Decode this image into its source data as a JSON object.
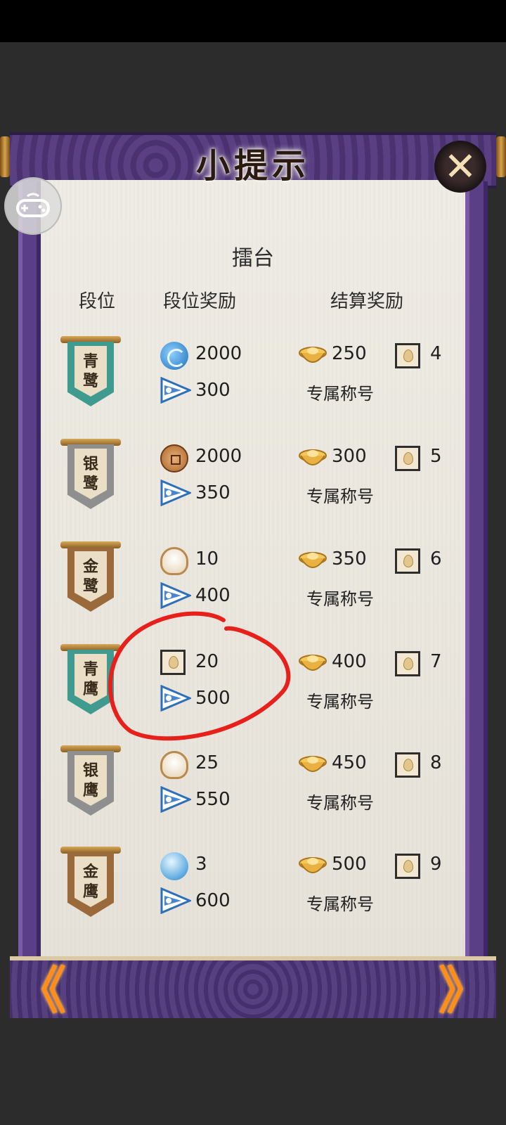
{
  "dialog": {
    "title": "小提示",
    "close_label": "✕",
    "prev_label": "《",
    "next_label": "》"
  },
  "section": {
    "title": "擂台"
  },
  "columns": {
    "rank": "段位",
    "rank_reward": "段位奖励",
    "settle_reward": "结算奖励"
  },
  "rows": [
    {
      "rank_name_top": "青",
      "rank_name_bottom": "鹭",
      "banner_color": "#3f9b8f",
      "reward1_icon": "swirl-icon",
      "reward1": "2000",
      "reward2_icon": "flag-icon",
      "reward2": "300",
      "settle_icon": "ingot-icon",
      "settle_gold": "250",
      "settle_card_icon": "card-icon",
      "settle_card": "4",
      "settle_title": "专属称号"
    },
    {
      "rank_name_top": "银",
      "rank_name_bottom": "鹭",
      "banner_color": "#8f8f8f",
      "reward1_icon": "coin-icon",
      "reward1": "2000",
      "reward2_icon": "flag-icon",
      "reward2": "350",
      "settle_icon": "ingot-icon",
      "settle_gold": "300",
      "settle_card_icon": "card-icon",
      "settle_card": "5",
      "settle_title": "专属称号"
    },
    {
      "rank_name_top": "金",
      "rank_name_bottom": "鹭",
      "banner_color": "#9a6a3a",
      "reward1_icon": "bun-icon",
      "reward1": "10",
      "reward2_icon": "flag-icon",
      "reward2": "400",
      "settle_icon": "ingot-icon",
      "settle_gold": "350",
      "settle_card_icon": "card-icon",
      "settle_card": "6",
      "settle_title": "专属称号"
    },
    {
      "rank_name_top": "青",
      "rank_name_bottom": "鹰",
      "banner_color": "#3f9b8f",
      "reward1_icon": "card-icon",
      "reward1": "20",
      "reward2_icon": "flag-icon",
      "reward2": "500",
      "settle_icon": "ingot-icon",
      "settle_gold": "400",
      "settle_card_icon": "card-icon",
      "settle_card": "7",
      "settle_title": "专属称号"
    },
    {
      "rank_name_top": "银",
      "rank_name_bottom": "鹰",
      "banner_color": "#8f8f8f",
      "reward1_icon": "bun-icon",
      "reward1": "25",
      "reward2_icon": "flag-icon",
      "reward2": "550",
      "settle_icon": "ingot-icon",
      "settle_gold": "450",
      "settle_card_icon": "card-icon",
      "settle_card": "8",
      "settle_title": "专属称号"
    },
    {
      "rank_name_top": "金",
      "rank_name_bottom": "鹰",
      "banner_color": "#9a6a3a",
      "reward1_icon": "orb-icon",
      "reward1": "3",
      "reward2_icon": "flag-icon",
      "reward2": "600",
      "settle_icon": "ingot-icon",
      "settle_gold": "500",
      "settle_card_icon": "card-icon",
      "settle_card": "9",
      "settle_title": "专属称号"
    }
  ],
  "annotation": {
    "color": "#e8201b",
    "icon": "red-circle-annotation"
  }
}
